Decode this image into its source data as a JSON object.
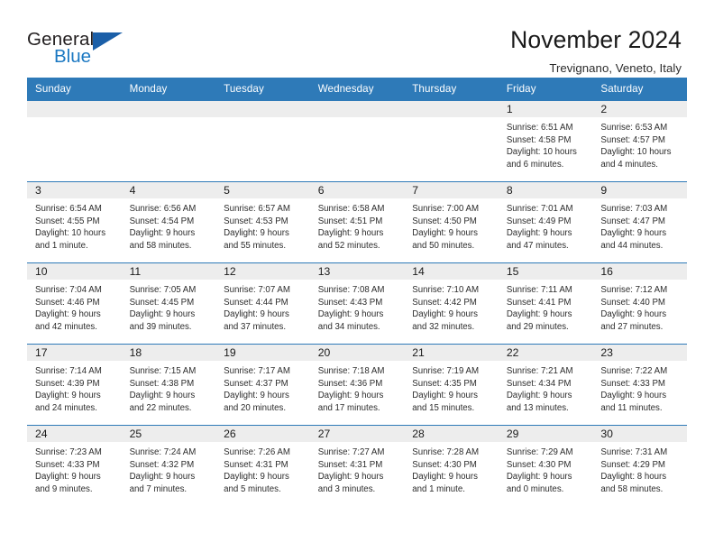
{
  "brand": {
    "name_part1": "General",
    "name_part2": "Blue",
    "triangle_color": "#1b5fa8",
    "blue_color": "#1b78c2"
  },
  "header": {
    "title": "November 2024",
    "subtitle": "Trevignano, Veneto, Italy"
  },
  "theme": {
    "header_blue": "#2e7ab8",
    "daynum_strip": "#ededed",
    "text": "#2c2c2c"
  },
  "weekdays": [
    "Sunday",
    "Monday",
    "Tuesday",
    "Wednesday",
    "Thursday",
    "Friday",
    "Saturday"
  ],
  "weeks": [
    [
      {
        "day": "",
        "empty": true
      },
      {
        "day": "",
        "empty": true
      },
      {
        "day": "",
        "empty": true
      },
      {
        "day": "",
        "empty": true
      },
      {
        "day": "",
        "empty": true
      },
      {
        "day": "1",
        "sunrise": "Sunrise: 6:51 AM",
        "sunset": "Sunset: 4:58 PM",
        "daylight1": "Daylight: 10 hours",
        "daylight2": "and 6 minutes."
      },
      {
        "day": "2",
        "sunrise": "Sunrise: 6:53 AM",
        "sunset": "Sunset: 4:57 PM",
        "daylight1": "Daylight: 10 hours",
        "daylight2": "and 4 minutes."
      }
    ],
    [
      {
        "day": "3",
        "sunrise": "Sunrise: 6:54 AM",
        "sunset": "Sunset: 4:55 PM",
        "daylight1": "Daylight: 10 hours",
        "daylight2": "and 1 minute."
      },
      {
        "day": "4",
        "sunrise": "Sunrise: 6:56 AM",
        "sunset": "Sunset: 4:54 PM",
        "daylight1": "Daylight: 9 hours",
        "daylight2": "and 58 minutes."
      },
      {
        "day": "5",
        "sunrise": "Sunrise: 6:57 AM",
        "sunset": "Sunset: 4:53 PM",
        "daylight1": "Daylight: 9 hours",
        "daylight2": "and 55 minutes."
      },
      {
        "day": "6",
        "sunrise": "Sunrise: 6:58 AM",
        "sunset": "Sunset: 4:51 PM",
        "daylight1": "Daylight: 9 hours",
        "daylight2": "and 52 minutes."
      },
      {
        "day": "7",
        "sunrise": "Sunrise: 7:00 AM",
        "sunset": "Sunset: 4:50 PM",
        "daylight1": "Daylight: 9 hours",
        "daylight2": "and 50 minutes."
      },
      {
        "day": "8",
        "sunrise": "Sunrise: 7:01 AM",
        "sunset": "Sunset: 4:49 PM",
        "daylight1": "Daylight: 9 hours",
        "daylight2": "and 47 minutes."
      },
      {
        "day": "9",
        "sunrise": "Sunrise: 7:03 AM",
        "sunset": "Sunset: 4:47 PM",
        "daylight1": "Daylight: 9 hours",
        "daylight2": "and 44 minutes."
      }
    ],
    [
      {
        "day": "10",
        "sunrise": "Sunrise: 7:04 AM",
        "sunset": "Sunset: 4:46 PM",
        "daylight1": "Daylight: 9 hours",
        "daylight2": "and 42 minutes."
      },
      {
        "day": "11",
        "sunrise": "Sunrise: 7:05 AM",
        "sunset": "Sunset: 4:45 PM",
        "daylight1": "Daylight: 9 hours",
        "daylight2": "and 39 minutes."
      },
      {
        "day": "12",
        "sunrise": "Sunrise: 7:07 AM",
        "sunset": "Sunset: 4:44 PM",
        "daylight1": "Daylight: 9 hours",
        "daylight2": "and 37 minutes."
      },
      {
        "day": "13",
        "sunrise": "Sunrise: 7:08 AM",
        "sunset": "Sunset: 4:43 PM",
        "daylight1": "Daylight: 9 hours",
        "daylight2": "and 34 minutes."
      },
      {
        "day": "14",
        "sunrise": "Sunrise: 7:10 AM",
        "sunset": "Sunset: 4:42 PM",
        "daylight1": "Daylight: 9 hours",
        "daylight2": "and 32 minutes."
      },
      {
        "day": "15",
        "sunrise": "Sunrise: 7:11 AM",
        "sunset": "Sunset: 4:41 PM",
        "daylight1": "Daylight: 9 hours",
        "daylight2": "and 29 minutes."
      },
      {
        "day": "16",
        "sunrise": "Sunrise: 7:12 AM",
        "sunset": "Sunset: 4:40 PM",
        "daylight1": "Daylight: 9 hours",
        "daylight2": "and 27 minutes."
      }
    ],
    [
      {
        "day": "17",
        "sunrise": "Sunrise: 7:14 AM",
        "sunset": "Sunset: 4:39 PM",
        "daylight1": "Daylight: 9 hours",
        "daylight2": "and 24 minutes."
      },
      {
        "day": "18",
        "sunrise": "Sunrise: 7:15 AM",
        "sunset": "Sunset: 4:38 PM",
        "daylight1": "Daylight: 9 hours",
        "daylight2": "and 22 minutes."
      },
      {
        "day": "19",
        "sunrise": "Sunrise: 7:17 AM",
        "sunset": "Sunset: 4:37 PM",
        "daylight1": "Daylight: 9 hours",
        "daylight2": "and 20 minutes."
      },
      {
        "day": "20",
        "sunrise": "Sunrise: 7:18 AM",
        "sunset": "Sunset: 4:36 PM",
        "daylight1": "Daylight: 9 hours",
        "daylight2": "and 17 minutes."
      },
      {
        "day": "21",
        "sunrise": "Sunrise: 7:19 AM",
        "sunset": "Sunset: 4:35 PM",
        "daylight1": "Daylight: 9 hours",
        "daylight2": "and 15 minutes."
      },
      {
        "day": "22",
        "sunrise": "Sunrise: 7:21 AM",
        "sunset": "Sunset: 4:34 PM",
        "daylight1": "Daylight: 9 hours",
        "daylight2": "and 13 minutes."
      },
      {
        "day": "23",
        "sunrise": "Sunrise: 7:22 AM",
        "sunset": "Sunset: 4:33 PM",
        "daylight1": "Daylight: 9 hours",
        "daylight2": "and 11 minutes."
      }
    ],
    [
      {
        "day": "24",
        "sunrise": "Sunrise: 7:23 AM",
        "sunset": "Sunset: 4:33 PM",
        "daylight1": "Daylight: 9 hours",
        "daylight2": "and 9 minutes."
      },
      {
        "day": "25",
        "sunrise": "Sunrise: 7:24 AM",
        "sunset": "Sunset: 4:32 PM",
        "daylight1": "Daylight: 9 hours",
        "daylight2": "and 7 minutes."
      },
      {
        "day": "26",
        "sunrise": "Sunrise: 7:26 AM",
        "sunset": "Sunset: 4:31 PM",
        "daylight1": "Daylight: 9 hours",
        "daylight2": "and 5 minutes."
      },
      {
        "day": "27",
        "sunrise": "Sunrise: 7:27 AM",
        "sunset": "Sunset: 4:31 PM",
        "daylight1": "Daylight: 9 hours",
        "daylight2": "and 3 minutes."
      },
      {
        "day": "28",
        "sunrise": "Sunrise: 7:28 AM",
        "sunset": "Sunset: 4:30 PM",
        "daylight1": "Daylight: 9 hours",
        "daylight2": "and 1 minute."
      },
      {
        "day": "29",
        "sunrise": "Sunrise: 7:29 AM",
        "sunset": "Sunset: 4:30 PM",
        "daylight1": "Daylight: 9 hours",
        "daylight2": "and 0 minutes."
      },
      {
        "day": "30",
        "sunrise": "Sunrise: 7:31 AM",
        "sunset": "Sunset: 4:29 PM",
        "daylight1": "Daylight: 8 hours",
        "daylight2": "and 58 minutes."
      }
    ]
  ]
}
